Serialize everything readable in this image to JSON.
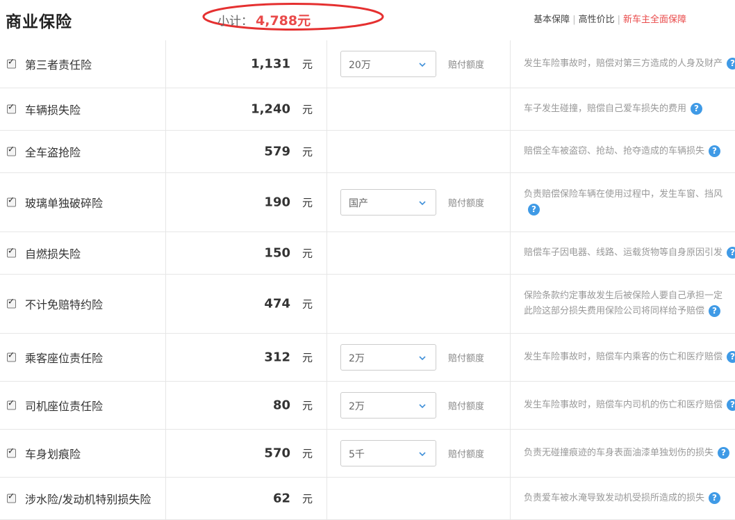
{
  "header": {
    "title": "商业保险",
    "subtotal_label": "小计：",
    "subtotal_value": "4,788元",
    "plans": [
      "基本保障",
      "高性价比",
      "新车主全面保障"
    ]
  },
  "rows": [
    {
      "name": "第三者责任险",
      "price": "1,131",
      "unit": "元",
      "select": "20万",
      "select_label": "赔付额度",
      "desc1": "发生车险事故时，赔偿对第三方造成的人身及财产",
      "desc2": ""
    },
    {
      "name": "车辆损失险",
      "price": "1,240",
      "unit": "元",
      "select": "",
      "select_label": "",
      "desc1": "车子发生碰撞，赔偿自己爱车损失的费用",
      "desc2": ""
    },
    {
      "name": "全车盗抢险",
      "price": "579",
      "unit": "元",
      "select": "",
      "select_label": "",
      "desc1": "赔偿全车被盗窃、抢劫、抢夺造成的车辆损失",
      "desc2": ""
    },
    {
      "name": "玻璃单独破碎险",
      "price": "190",
      "unit": "元",
      "select": "国产",
      "select_label": "赔付额度",
      "desc1": "负责赔偿保险车辆在使用过程中，发生车窗、挡风",
      "desc2": ""
    },
    {
      "name": "自燃损失险",
      "price": "150",
      "unit": "元",
      "select": "",
      "select_label": "",
      "desc1": "赔偿车子因电器、线路、运载货物等自身原因引发",
      "desc2": ""
    },
    {
      "name": "不计免赔特约险",
      "price": "474",
      "unit": "元",
      "select": "",
      "select_label": "",
      "desc1": "保险条款约定事故发生后被保险人要自己承担一定",
      "desc2": "此险这部分损失费用保险公司将同样给予赔偿"
    },
    {
      "name": "乘客座位责任险",
      "price": "312",
      "unit": "元",
      "select": "2万",
      "select_label": "赔付额度",
      "desc1": "发生车险事故时，赔偿车内乘客的伤亡和医疗赔偿",
      "desc2": ""
    },
    {
      "name": "司机座位责任险",
      "price": "80",
      "unit": "元",
      "select": "2万",
      "select_label": "赔付额度",
      "desc1": "发生车险事故时，赔偿车内司机的伤亡和医疗赔偿",
      "desc2": ""
    },
    {
      "name": "车身划痕险",
      "price": "570",
      "unit": "元",
      "select": "5千",
      "select_label": "赔付额度",
      "desc1": "负责无碰撞痕迹的车身表面油漆单独划伤的损失",
      "desc2": ""
    },
    {
      "name": "涉水险/发动机特别损失险",
      "price": "62",
      "unit": "元",
      "select": "",
      "select_label": "",
      "desc1": "负责爱车被水淹导致发动机受损所造成的损失",
      "desc2": ""
    }
  ],
  "help_icon": "?",
  "colors": {
    "accent": "#e94a4a",
    "help": "#3f9ae6"
  }
}
